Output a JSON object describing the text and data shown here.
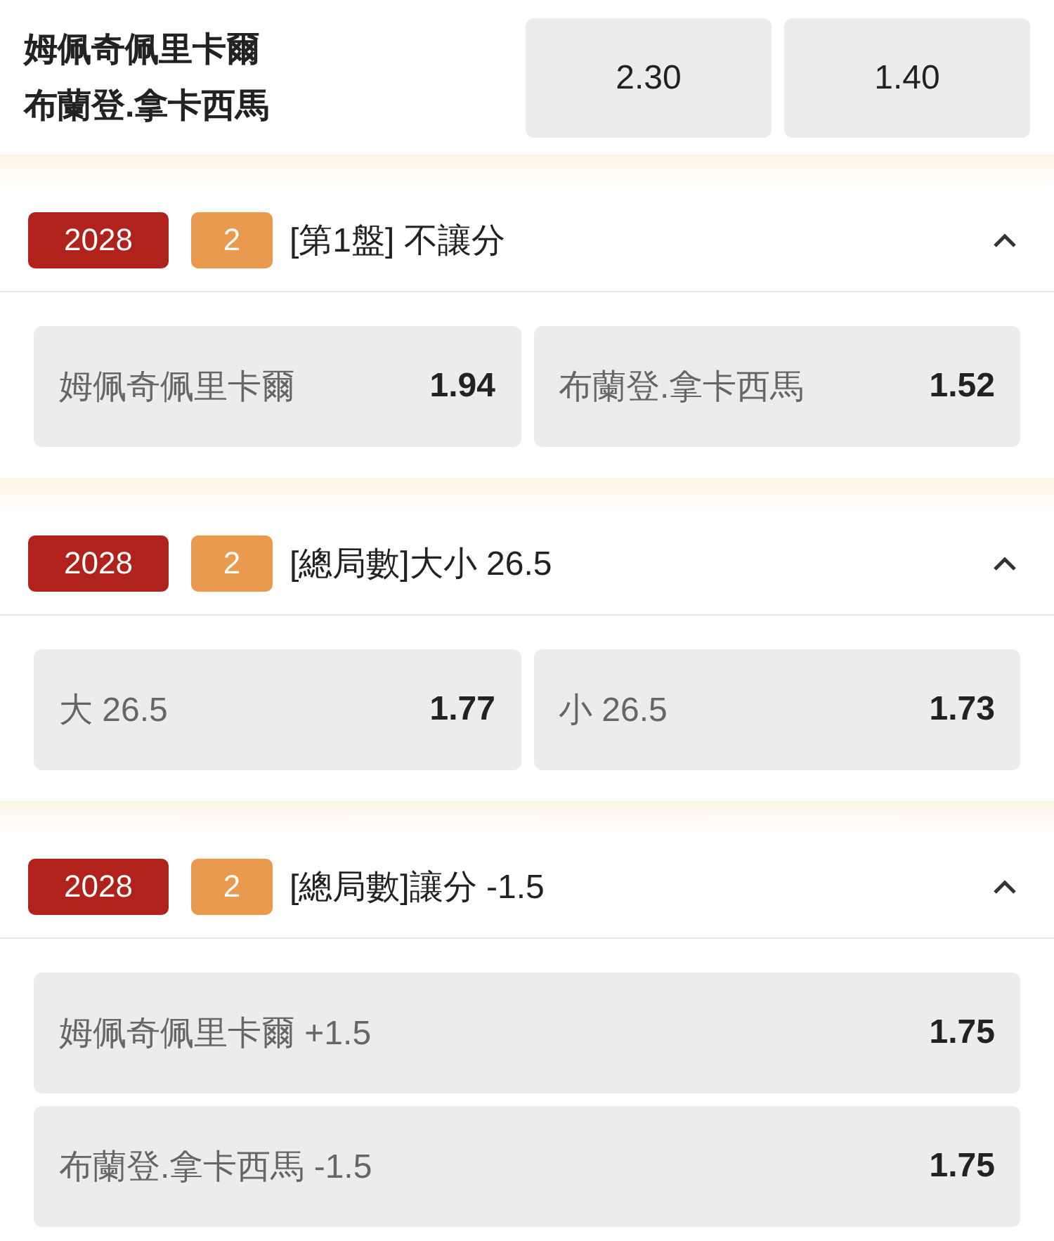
{
  "match": {
    "teams": [
      "姆佩奇佩里卡爾",
      "布蘭登.拿卡西馬"
    ],
    "odds": [
      "2.30",
      "1.40"
    ]
  },
  "markets": [
    {
      "code": "2028",
      "count": "2",
      "title": "[第1盤] 不讓分",
      "expanded": true,
      "kind": "grid",
      "options": [
        {
          "label": "姆佩奇佩里卡爾",
          "odds": "1.94"
        },
        {
          "label": "布蘭登.拿卡西馬",
          "odds": "1.52"
        }
      ]
    },
    {
      "code": "2028",
      "count": "2",
      "title": "[總局數]大小 26.5",
      "expanded": true,
      "kind": "grid",
      "options": [
        {
          "label": "大 26.5",
          "odds": "1.77"
        },
        {
          "label": "小 26.5",
          "odds": "1.73"
        }
      ]
    },
    {
      "code": "2028",
      "count": "2",
      "title": "[總局數]讓分 -1.5",
      "expanded": true,
      "kind": "list",
      "options": [
        {
          "label": "姆佩奇佩里卡爾 +1.5",
          "odds": "1.75"
        },
        {
          "label": "布蘭登.拿卡西馬 -1.5",
          "odds": "1.75"
        }
      ]
    }
  ]
}
